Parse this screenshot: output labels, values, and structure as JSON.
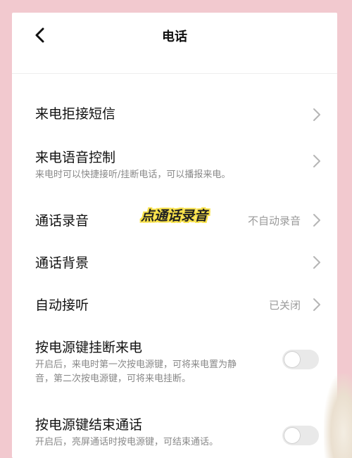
{
  "header": {
    "title": "电话",
    "back_icon": "chevron-left-icon"
  },
  "rows": [
    {
      "id": "sms-reject",
      "title": "来电拒接短信",
      "subtitle": "",
      "value": "",
      "control": "chevron"
    },
    {
      "id": "voice-control",
      "title": "来电语音控制",
      "subtitle": "来电时可以快捷接听/挂断电话，可以播报来电。",
      "value": "",
      "control": "chevron"
    },
    {
      "id": "call-recording",
      "title": "通话录音",
      "subtitle": "",
      "value": "不自动录音",
      "control": "chevron"
    },
    {
      "id": "call-background",
      "title": "通话背景",
      "subtitle": "",
      "value": "",
      "control": "chevron"
    },
    {
      "id": "auto-answer",
      "title": "自动接听",
      "subtitle": "",
      "value": "已关闭",
      "control": "chevron"
    },
    {
      "id": "power-hangup",
      "title": "按电源键挂断来电",
      "subtitle": "开启后，来电时第一次按电源键，可将来电置为静音，第二次按电源键，可将来电挂断。",
      "value": "",
      "control": "toggle",
      "toggle_on": false
    },
    {
      "id": "power-end-call",
      "title": "按电源键结束通话",
      "subtitle": "开启后，亮屏通话时按电源键，可结束通话。",
      "value": "",
      "control": "toggle",
      "toggle_on": false
    }
  ],
  "annotation": "点通话录音",
  "colors": {
    "background": "#f2c9cf",
    "annotation_highlight": "#f9e24a",
    "toggle_off": "#e9e9e9"
  }
}
